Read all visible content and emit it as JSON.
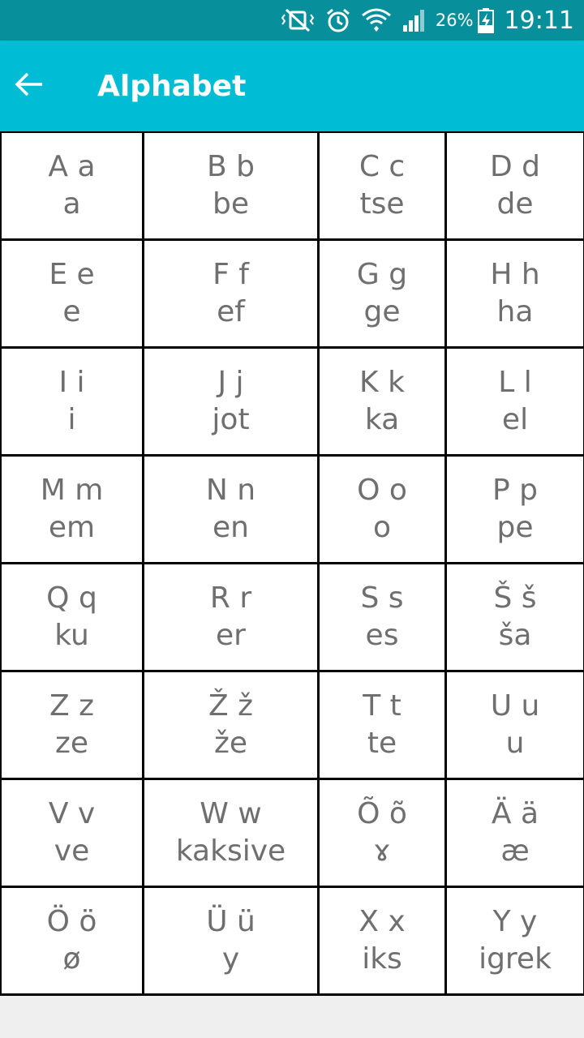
{
  "status_bar": {
    "battery_percent": "26%",
    "time": "19:11",
    "icons": [
      "vibrate-mute-icon",
      "alarm-icon",
      "wifi-icon",
      "signal-icon",
      "battery-charging-icon"
    ]
  },
  "app_bar": {
    "title": "Alphabet",
    "back_icon": "arrow-left-icon"
  },
  "colors": {
    "status_bar": "#078f9c",
    "app_bar": "#00bcd4",
    "cell_text": "#6f6f6f",
    "grid_line": "#000000",
    "background": "#efefef"
  },
  "alphabet": [
    {
      "letters": "A a",
      "name": "a"
    },
    {
      "letters": "B b",
      "name": "be"
    },
    {
      "letters": "C c",
      "name": "tse"
    },
    {
      "letters": "D d",
      "name": "de"
    },
    {
      "letters": "E e",
      "name": "e"
    },
    {
      "letters": "F f",
      "name": "ef"
    },
    {
      "letters": "G g",
      "name": "ge"
    },
    {
      "letters": "H h",
      "name": "ha"
    },
    {
      "letters": "I i",
      "name": "i"
    },
    {
      "letters": "J j",
      "name": "jot"
    },
    {
      "letters": "K k",
      "name": "ka"
    },
    {
      "letters": "L l",
      "name": "el"
    },
    {
      "letters": "M m",
      "name": "em"
    },
    {
      "letters": "N n",
      "name": "en"
    },
    {
      "letters": "O o",
      "name": "o"
    },
    {
      "letters": "P p",
      "name": "pe"
    },
    {
      "letters": "Q q",
      "name": "ku"
    },
    {
      "letters": "R r",
      "name": "er"
    },
    {
      "letters": "S s",
      "name": "es"
    },
    {
      "letters": "Š š",
      "name": "ša"
    },
    {
      "letters": "Z z",
      "name": "ze"
    },
    {
      "letters": "Ž ž",
      "name": "že"
    },
    {
      "letters": "T t",
      "name": "te"
    },
    {
      "letters": "U u",
      "name": "u"
    },
    {
      "letters": "V v",
      "name": "ve"
    },
    {
      "letters": "W w",
      "name": "kaksive"
    },
    {
      "letters": "Õ õ",
      "name": "ɤ"
    },
    {
      "letters": "Ä ä",
      "name": "æ"
    },
    {
      "letters": "Ö ö",
      "name": "ø"
    },
    {
      "letters": "Ü ü",
      "name": "y"
    },
    {
      "letters": "X x",
      "name": "iks"
    },
    {
      "letters": "Y y",
      "name": "igrek"
    }
  ]
}
